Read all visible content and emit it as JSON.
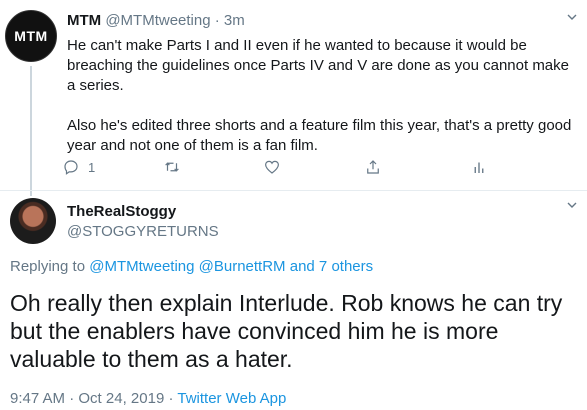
{
  "tweet1": {
    "avatar_text": "MTM",
    "name": "MTM",
    "handle": "@MTMtweeting",
    "separator": "·",
    "time": "3m",
    "paragraph1": "He can't make Parts I and II even if he wanted to because it would be breaching the guidelines once Parts IV and V are done as you cannot make a series.",
    "paragraph2": "Also he's edited three shorts and a feature film this year, that's a pretty good year and not one of them is a fan film.",
    "reply_count": "1",
    "icons": [
      "reply-icon",
      "retweet-icon",
      "like-icon",
      "share-icon",
      "analytics-icon"
    ]
  },
  "tweet2": {
    "name": "TheRealStoggy",
    "handle": "@STOGGYRETURNS",
    "replying_prefix": "Replying to",
    "mention1": "@MTMtweeting",
    "mention2": "@BurnettRM",
    "and_others": "and 7 others",
    "text": "Oh really then explain Interlude. Rob knows he can try but the enablers have convinced him he is more valuable to them as a hater.",
    "time": "9:47 AM",
    "separator": "·",
    "date": "Oct 24, 2019",
    "source": "Twitter Web App"
  },
  "colors": {
    "link": "#1b95e0",
    "secondary_text": "#657786",
    "primary_text": "#14171a",
    "divider": "#e6ecf0"
  }
}
